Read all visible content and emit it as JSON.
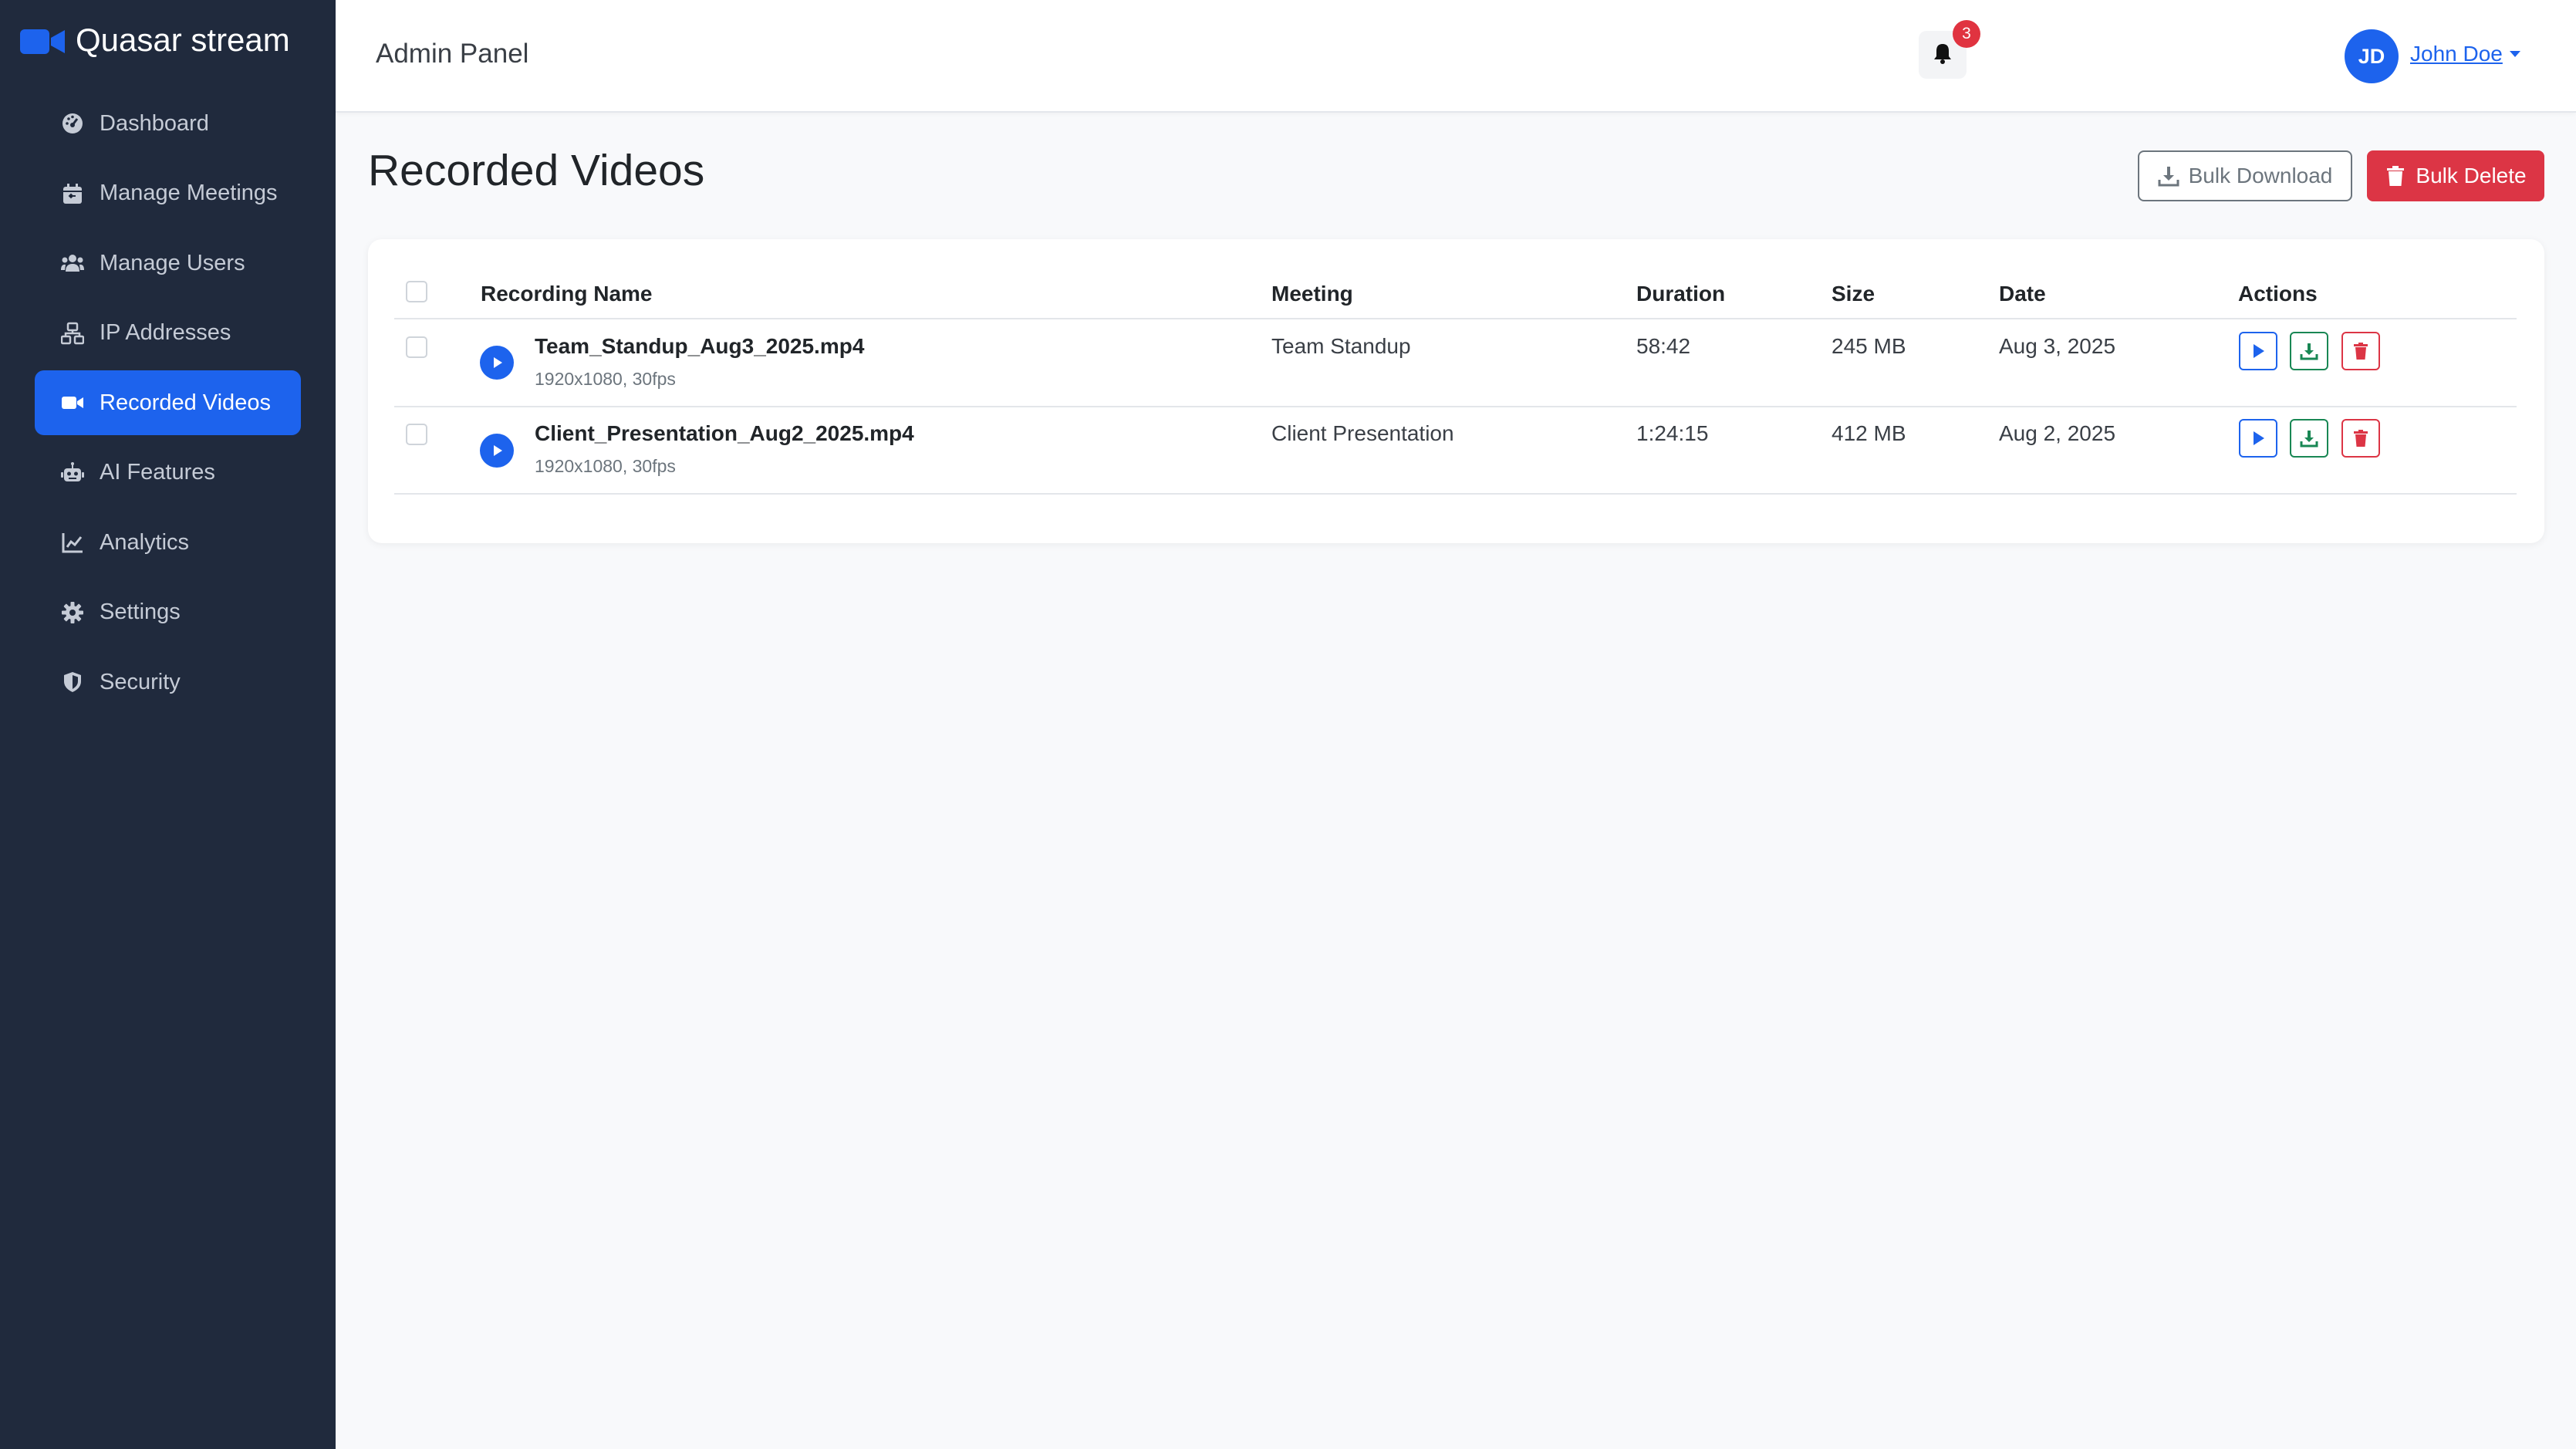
{
  "brand": {
    "name": "Quasar stream",
    "icon": "video-camera-icon",
    "color": "#1d63ed"
  },
  "sidebar": {
    "items": [
      {
        "label": "Dashboard",
        "icon": "dashboard-gauge-icon",
        "active": false
      },
      {
        "label": "Manage Meetings",
        "icon": "calendar-icon",
        "active": false
      },
      {
        "label": "Manage Users",
        "icon": "users-icon",
        "active": false
      },
      {
        "label": "IP Addresses",
        "icon": "network-icon",
        "active": false
      },
      {
        "label": "Recorded Videos",
        "icon": "video-camera-icon",
        "active": true
      },
      {
        "label": "AI Features",
        "icon": "robot-icon",
        "active": false
      },
      {
        "label": "Analytics",
        "icon": "chart-line-icon",
        "active": false
      },
      {
        "label": "Settings",
        "icon": "gear-icon",
        "active": false
      },
      {
        "label": "Security",
        "icon": "shield-icon",
        "active": false
      }
    ]
  },
  "header": {
    "title": "Admin Panel",
    "notifications_count": "3",
    "user": {
      "initials": "JD",
      "name": "John Doe"
    }
  },
  "page": {
    "title": "Recorded Videos",
    "bulk_download_label": "Bulk Download",
    "bulk_delete_label": "Bulk Delete"
  },
  "table": {
    "columns": {
      "name": "Recording Name",
      "meeting": "Meeting",
      "duration": "Duration",
      "size": "Size",
      "date": "Date",
      "actions": "Actions"
    },
    "rows": [
      {
        "name": "Team_Standup_Aug3_2025.mp4",
        "meta": "1920x1080, 30fps",
        "meeting": "Team Standup",
        "duration": "58:42",
        "size": "245 MB",
        "date": "Aug 3, 2025"
      },
      {
        "name": "Client_Presentation_Aug2_2025.mp4",
        "meta": "1920x1080, 30fps",
        "meeting": "Client Presentation",
        "duration": "1:24:15",
        "size": "412 MB",
        "date": "Aug 2, 2025"
      }
    ]
  },
  "colors": {
    "primary": "#1d63ed",
    "danger": "#dc3545",
    "success": "#198754",
    "sidebar_bg": "#202a3d"
  }
}
